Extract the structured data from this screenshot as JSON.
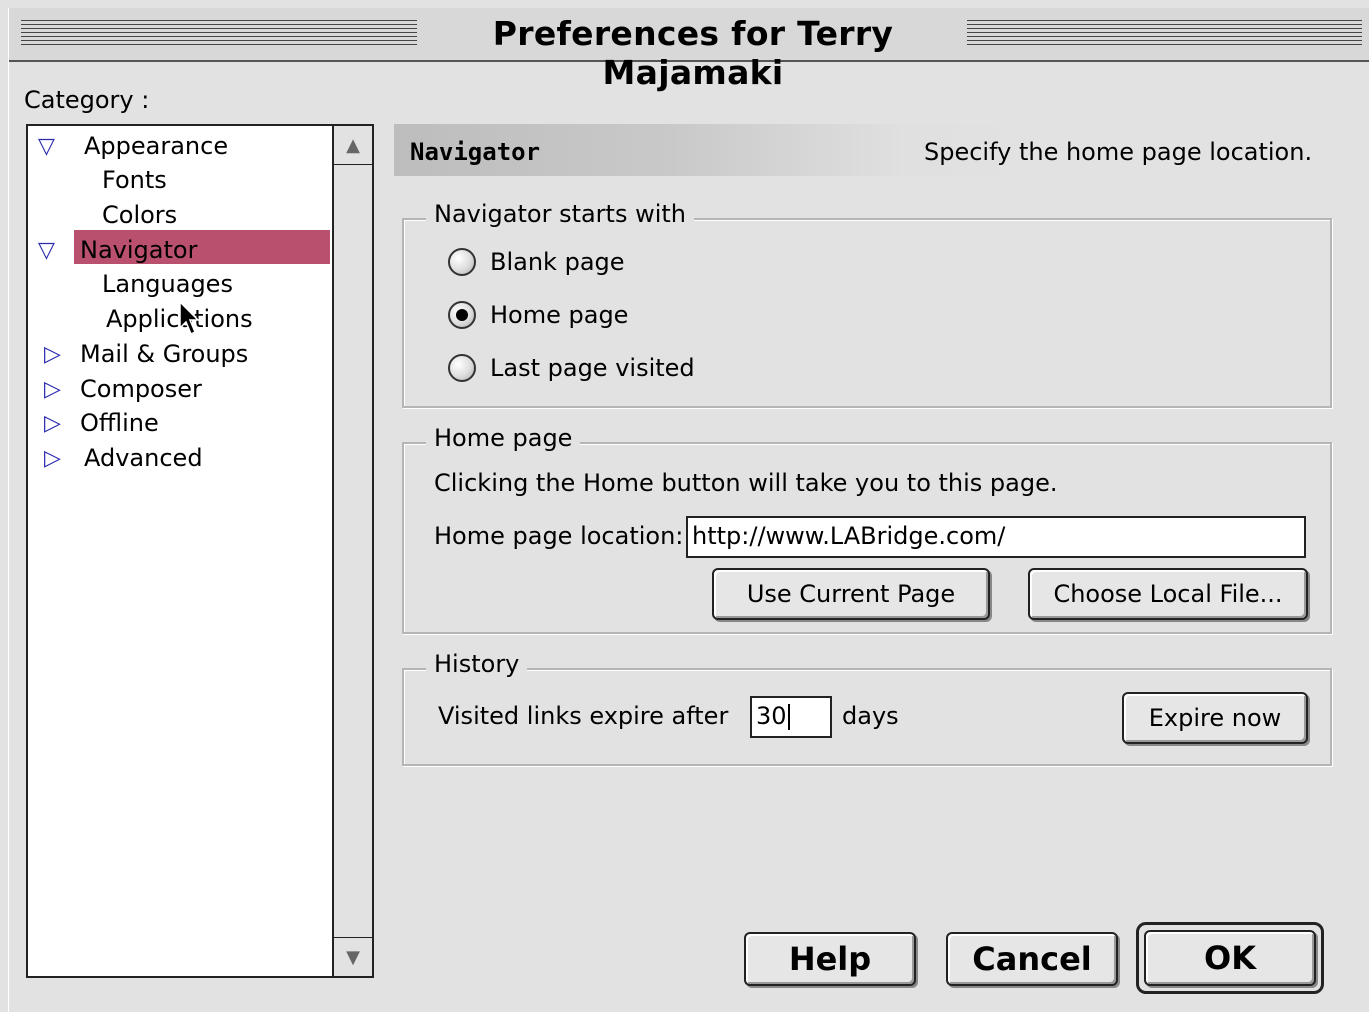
{
  "window": {
    "title": "Preferences for Terry Majamaki"
  },
  "sidebar": {
    "label": "Category :",
    "items": [
      {
        "label": "Appearance",
        "level": 0,
        "expanded": true,
        "selected": false
      },
      {
        "label": "Fonts",
        "level": 1,
        "selected": false
      },
      {
        "label": "Colors",
        "level": 1,
        "selected": false
      },
      {
        "label": "Navigator",
        "level": 0,
        "expanded": true,
        "selected": true
      },
      {
        "label": "Languages",
        "level": 1,
        "selected": false
      },
      {
        "label": "Applications",
        "level": 1,
        "selected": false
      },
      {
        "label": "Mail & Groups",
        "level": 0,
        "expanded": false,
        "selected": false
      },
      {
        "label": "Composer",
        "level": 0,
        "expanded": false,
        "selected": false
      },
      {
        "label": "Offline",
        "level": 0,
        "expanded": false,
        "selected": false
      },
      {
        "label": "Advanced",
        "level": 0,
        "expanded": false,
        "selected": false
      }
    ],
    "selection_color": "#b9506e"
  },
  "panel": {
    "title": "Navigator",
    "description": "Specify the home page location.",
    "starts_with": {
      "legend": "Navigator starts with",
      "options": [
        {
          "label": "Blank page",
          "checked": false
        },
        {
          "label": "Home page",
          "checked": true
        },
        {
          "label": "Last page visited",
          "checked": false
        }
      ]
    },
    "home_page": {
      "legend": "Home page",
      "note": "Clicking the Home button will take you to this page.",
      "location_label": "Home page location:",
      "location_value": "http://www.LABridge.com/",
      "use_current_label": "Use Current Page",
      "choose_file_label": "Choose Local File..."
    },
    "history": {
      "legend": "History",
      "prefix": "Visited links expire after",
      "days_value": "30",
      "suffix": "days",
      "expire_label": "Expire now"
    }
  },
  "footer": {
    "help_label": "Help",
    "cancel_label": "Cancel",
    "ok_label": "OK"
  }
}
